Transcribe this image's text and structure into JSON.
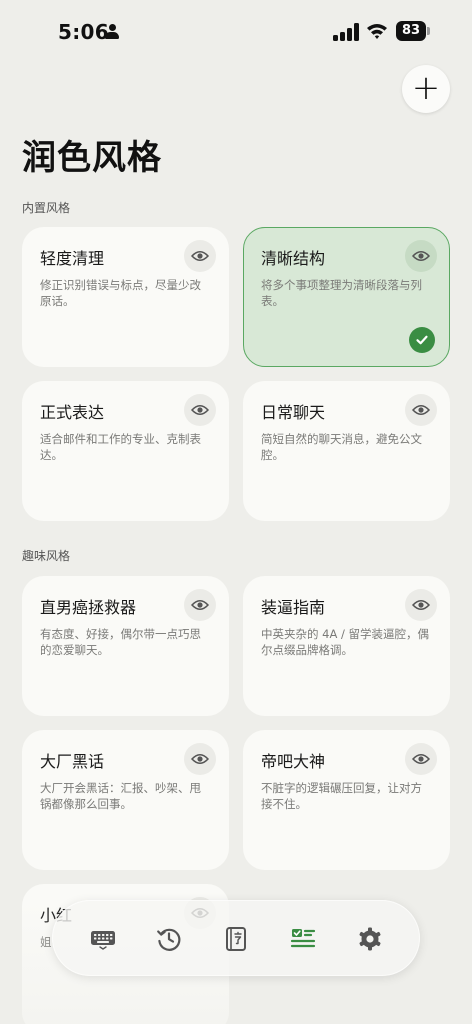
{
  "status_bar": {
    "time": "5:06",
    "battery": "83"
  },
  "header": {
    "add_label": "+",
    "title": "润色风格"
  },
  "sections": [
    {
      "label": "内置风格"
    },
    {
      "label": "趣味风格"
    }
  ],
  "cards": [
    {
      "title": "轻度清理",
      "desc": "修正识别错误与标点，尽量少改原话。",
      "selected": false
    },
    {
      "title": "清晰结构",
      "desc": "将多个事项整理为清晰段落与列表。",
      "selected": true
    },
    {
      "title": "正式表达",
      "desc": "适合邮件和工作的专业、克制表达。",
      "selected": false
    },
    {
      "title": "日常聊天",
      "desc": "简短自然的聊天消息，避免公文腔。",
      "selected": false
    },
    {
      "title": "直男癌拯救器",
      "desc": "有态度、好接，偶尔带一点巧思的恋爱聊天。",
      "selected": false
    },
    {
      "title": "装逼指南",
      "desc": "中英夹杂的 4A / 留学装逼腔，偶尔点缀品牌格调。",
      "selected": false
    },
    {
      "title": "大厂黑话",
      "desc": "大厂开会黑话：汇报、吵架、甩锅都像那么回事。",
      "selected": false
    },
    {
      "title": "帝吧大神",
      "desc": "不脏字的逻辑碾压回复，让对方接不住。",
      "selected": false
    },
    {
      "title": "小红",
      "desc": "姐",
      "selected": false
    }
  ],
  "nav": [
    {
      "name": "keyboard-icon",
      "active": false
    },
    {
      "name": "history-icon",
      "active": false
    },
    {
      "name": "dictionary-icon",
      "active": false
    },
    {
      "name": "styles-icon",
      "active": true
    },
    {
      "name": "settings-icon",
      "active": false
    }
  ],
  "colors": {
    "accent": "#3a8d43",
    "selected_bg": "#d8e8d6",
    "background": "#eeeeea"
  }
}
